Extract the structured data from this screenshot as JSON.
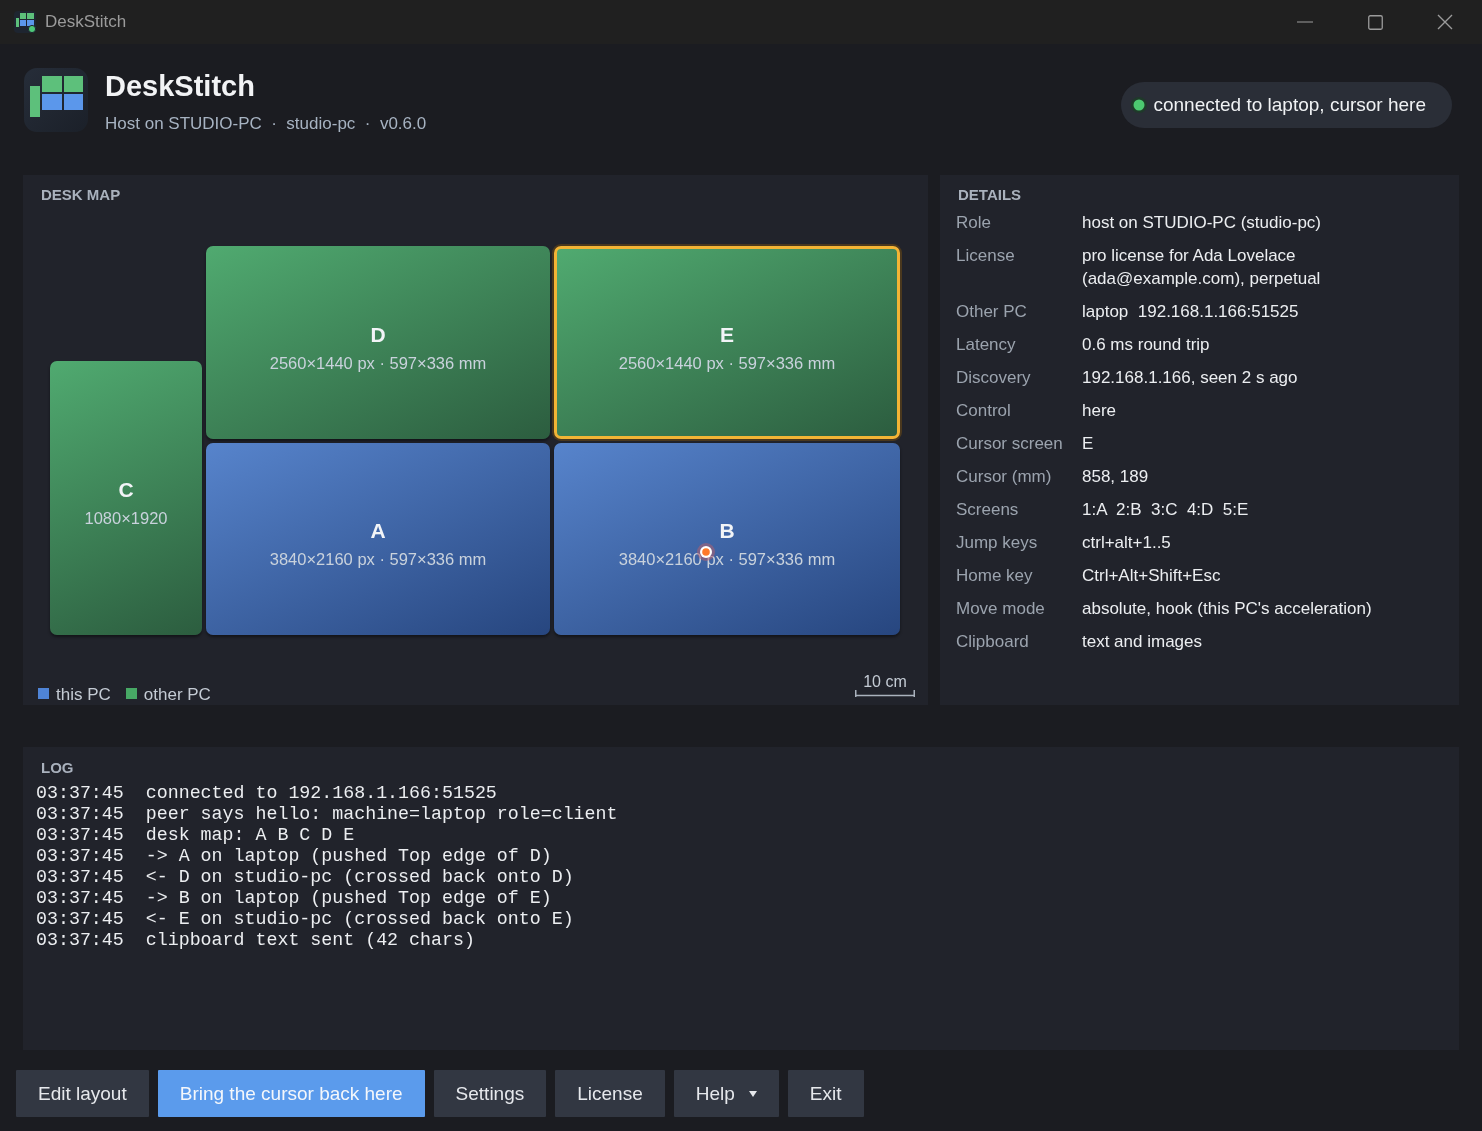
{
  "window": {
    "title": "DeskStitch"
  },
  "header": {
    "title": "DeskStitch",
    "subtitle": "Host on STUDIO-PC  ·  studio-pc  ·  v0.6.0",
    "status": {
      "text": "connected to laptop, cursor here",
      "connected": true
    }
  },
  "desk_map": {
    "title": "DESK MAP",
    "screens": [
      {
        "label": "D",
        "resolution": "2560×1440 px · 597×336 mm",
        "kind": "other",
        "selected": false,
        "cursor": false
      },
      {
        "label": "E",
        "resolution": "2560×1440 px · 597×336 mm",
        "kind": "other",
        "selected": true,
        "cursor": false
      },
      {
        "label": "C",
        "resolution": "1080×1920",
        "kind": "other",
        "selected": false,
        "cursor": false
      },
      {
        "label": "A",
        "resolution": "3840×2160 px · 597×336 mm",
        "kind": "this",
        "selected": false,
        "cursor": false
      },
      {
        "label": "B",
        "resolution": "3840×2160 px · 597×336 mm",
        "kind": "this",
        "selected": false,
        "cursor": true
      }
    ],
    "legend": [
      {
        "label": "this PC",
        "color": "#4f84d6"
      },
      {
        "label": "other PC",
        "color": "#47a865"
      }
    ],
    "scale": "10 cm"
  },
  "details": {
    "title": "DETAILS",
    "rows": [
      {
        "label": "Role",
        "value": "host on STUDIO-PC (studio-pc)"
      },
      {
        "label": "License",
        "value": "pro license for Ada Lovelace (ada@example.com), perpetual"
      },
      {
        "label": "Other PC",
        "value": "laptop  192.168.1.166:51525"
      },
      {
        "label": "Latency",
        "value": "0.6 ms round trip"
      },
      {
        "label": "Discovery",
        "value": "192.168.1.166, seen 2 s ago"
      },
      {
        "label": "Control",
        "value": "here"
      },
      {
        "label": "Cursor screen",
        "value": "E"
      },
      {
        "label": "Cursor (mm)",
        "value": "858, 189"
      },
      {
        "label": "Screens",
        "value": "1:A  2:B  3:C  4:D  5:E"
      },
      {
        "label": "Jump keys",
        "value": "ctrl+alt+1..5"
      },
      {
        "label": "Home key",
        "value": "Ctrl+Alt+Shift+Esc"
      },
      {
        "label": "Move mode",
        "value": "absolute, hook (this PC's acceleration)"
      },
      {
        "label": "Clipboard",
        "value": "text and images"
      }
    ]
  },
  "log": {
    "title": "LOG",
    "entries": [
      {
        "time": "03:37:45",
        "message": "connected to 192.168.1.166:51525"
      },
      {
        "time": "03:37:45",
        "message": "peer says hello: machine=laptop role=client"
      },
      {
        "time": "03:37:45",
        "message": "desk map: A B C D E"
      },
      {
        "time": "03:37:45",
        "message": "-> A on laptop (pushed Top edge of D)"
      },
      {
        "time": "03:37:45",
        "message": "<- D on studio-pc (crossed back onto D)"
      },
      {
        "time": "03:37:45",
        "message": "-> B on laptop (pushed Top edge of E)"
      },
      {
        "time": "03:37:45",
        "message": "<- E on studio-pc (crossed back onto E)"
      },
      {
        "time": "03:37:45",
        "message": "clipboard text sent (42 chars)"
      }
    ]
  },
  "buttons": [
    {
      "label": "Edit layout",
      "primary": false,
      "menu": false
    },
    {
      "label": "Bring the cursor back here",
      "primary": true,
      "menu": false
    },
    {
      "label": "Settings",
      "primary": false,
      "menu": false
    },
    {
      "label": "License",
      "primary": false,
      "menu": false
    },
    {
      "label": "Help",
      "primary": false,
      "menu": true
    },
    {
      "label": "Exit",
      "primary": false,
      "menu": false
    }
  ]
}
